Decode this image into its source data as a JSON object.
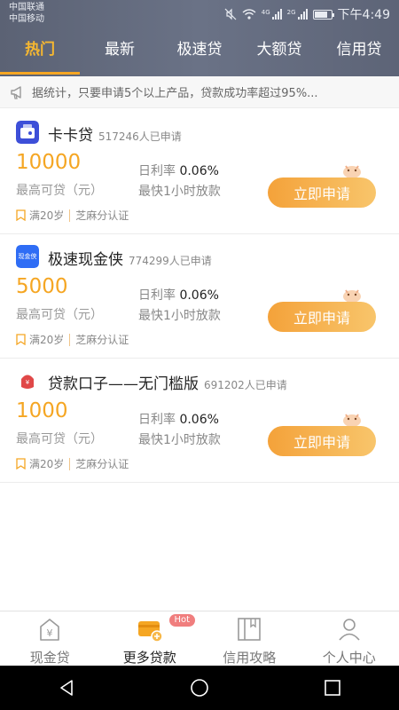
{
  "status": {
    "carrier1": "中国联通",
    "carrier2": "中国移动",
    "net1": "4G",
    "net2": "2G",
    "time": "下午4:49"
  },
  "tabs": [
    {
      "label": "热门"
    },
    {
      "label": "最新"
    },
    {
      "label": "极速贷"
    },
    {
      "label": "大额贷"
    },
    {
      "label": "信用贷"
    }
  ],
  "notice": {
    "text": "据统计，只要申请5个以上产品，贷款成功率超过95%..."
  },
  "items": [
    {
      "name": "卡卡贷",
      "count": "517246人已申请",
      "amount": "10000",
      "amount_label": "最高可贷（元）",
      "rate_label": "日利率",
      "rate_value": "0.06%",
      "speed": "最快1小时放款",
      "tag1": "满20岁",
      "tag2": "芝麻分认证",
      "button": "立即申请",
      "logo_color": "#3d4fd8"
    },
    {
      "name": "极速现金侠",
      "count": "774299人已申请",
      "amount": "5000",
      "amount_label": "最高可贷（元）",
      "rate_label": "日利率",
      "rate_value": "0.06%",
      "speed": "最快1小时放款",
      "tag1": "满20岁",
      "tag2": "芝麻分认证",
      "button": "立即申请",
      "logo_color": "#2f6df5",
      "logo_text": "现金侠"
    },
    {
      "name": "贷款口子——无门槛版",
      "count": "691202人已申请",
      "amount": "1000",
      "amount_label": "最高可贷（元）",
      "rate_label": "日利率",
      "rate_value": "0.06%",
      "speed": "最快1小时放款",
      "tag1": "满20岁",
      "tag2": "芝麻分认证",
      "button": "立即申请",
      "logo_color": "#e04848"
    }
  ],
  "bottom_nav": [
    {
      "label": "现金贷",
      "icon": "wallet-yen-icon"
    },
    {
      "label": "更多贷款",
      "icon": "credit-card-plus-icon",
      "badge": "Hot"
    },
    {
      "label": "信用攻略",
      "icon": "book-icon"
    },
    {
      "label": "个人中心",
      "icon": "person-icon"
    }
  ],
  "colors": {
    "accent": "#f5a623",
    "header": "#5f6679"
  }
}
